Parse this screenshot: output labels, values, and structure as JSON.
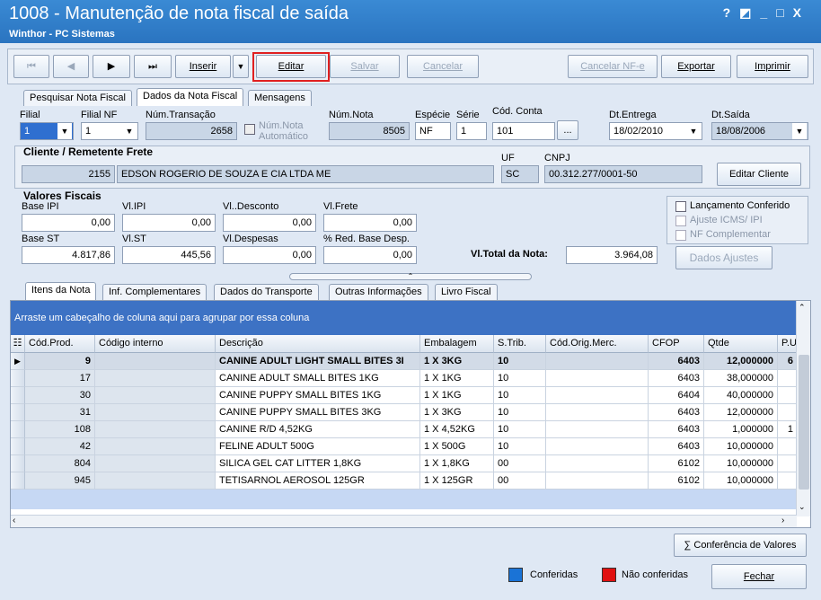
{
  "window": {
    "title": "1008 - Manutenção de nota fiscal de saída",
    "subtitle": "Winthor - PC Sistemas",
    "controls": [
      "?",
      "◩",
      "_",
      "□",
      "X"
    ]
  },
  "toolbar": {
    "first": "⏮",
    "prev": "◀",
    "next": "▶",
    "last": "⏭",
    "inserir": "Inserir",
    "dropdown": "▼",
    "editar": "Editar",
    "salvar": "Salvar",
    "cancelar": "Cancelar",
    "cancelar_nfe": "Cancelar NF-e",
    "exportar": "Exportar",
    "imprimir": "Imprimir",
    "highlight_color": "#e02020"
  },
  "main_tabs": [
    "Pesquisar Nota Fiscal",
    "Dados da Nota Fiscal",
    "Mensagens"
  ],
  "form": {
    "filial_label": "Filial",
    "filial_value": "1",
    "filial_nf_label": "Filial NF",
    "filial_nf_value": "1",
    "num_transacao_label": "Núm.Transação",
    "num_transacao_value": "2658",
    "num_nota_auto_label": "Núm.Nota Automático",
    "num_nota_label": "Núm.Nota",
    "num_nota_value": "8505",
    "especie_label": "Espécie",
    "especie_value": "NF",
    "serie_label": "Série",
    "serie_value": "1",
    "cod_conta_label": "Cód. Conta",
    "cod_conta_value": "101",
    "cod_conta_btn": "...",
    "dt_entrega_label": "Dt.Entrega",
    "dt_entrega_value": "18/02/2010",
    "dt_saida_label": "Dt.Saída",
    "dt_saida_value": "18/08/2006"
  },
  "cliente": {
    "section_label": "Cliente / Remetente Frete",
    "codigo": "2155",
    "nome": "EDSON ROGERIO DE SOUZA E CIA LTDA ME",
    "uf_label": "UF",
    "uf_value": "SC",
    "cnpj_label": "CNPJ",
    "cnpj_value": "00.312.277/0001-50",
    "editar_btn": "Editar Cliente"
  },
  "valores": {
    "section_label": "Valores Fiscais",
    "base_ipi_label": "Base IPI",
    "base_ipi_value": "0,00",
    "vl_ipi_label": "Vl.IPI",
    "vl_ipi_value": "0,00",
    "vl_desconto_label": "Vl..Desconto",
    "vl_desconto_value": "0,00",
    "vl_frete_label": "Vl.Frete",
    "vl_frete_value": "0,00",
    "base_st_label": "Base ST",
    "base_st_value": "4.817,86",
    "vl_st_label": "Vl.ST",
    "vl_st_value": "445,56",
    "vl_despesas_label": "Vl.Despesas",
    "vl_despesas_value": "0,00",
    "red_base_label": "% Red. Base Desp.",
    "red_base_value": "0,00",
    "total_label": "Vl.Total da Nota:",
    "total_value": "3.964,08"
  },
  "options": {
    "lancamento": "Lançamento Conferido",
    "ajuste": "Ajuste ICMS/ IPI",
    "nf_complementar": "NF Complementar",
    "dados_ajustes": "Dados Ajustes"
  },
  "sub_tabs": [
    "Itens da Nota",
    "Inf. Complementares",
    "Dados do Transporte",
    "Outras Informações",
    "Livro Fiscal"
  ],
  "grid": {
    "group_hint": "Arraste um cabeçalho de coluna aqui para agrupar por essa coluna",
    "columns": [
      "Cód.Prod.",
      "Código interno",
      "Descrição",
      "Embalagem",
      "S.Trib.",
      "Cód.Orig.Merc.",
      "CFOP",
      "Qtde",
      "P.U"
    ],
    "rows": [
      [
        "9",
        "",
        "CANINE ADULT LIGHT SMALL BITES 3I",
        "1 X 3KG",
        "10",
        "",
        "6403",
        "12,000000",
        "6"
      ],
      [
        "17",
        "",
        "CANINE ADULT SMALL BITES 1KG",
        "1 X 1KG",
        "10",
        "",
        "6403",
        "38,000000",
        ""
      ],
      [
        "30",
        "",
        "CANINE PUPPY SMALL BITES 1KG",
        "1 X 1KG",
        "10",
        "",
        "6404",
        "40,000000",
        ""
      ],
      [
        "31",
        "",
        "CANINE PUPPY SMALL BITES 3KG",
        "1 X 3KG",
        "10",
        "",
        "6403",
        "12,000000",
        ""
      ],
      [
        "108",
        "",
        "CANINE R/D 4,52KG",
        "1 X 4,52KG",
        "10",
        "",
        "6403",
        "1,000000",
        "1"
      ],
      [
        "42",
        "",
        "FELINE ADULT 500G",
        "1 X 500G",
        "10",
        "",
        "6403",
        "10,000000",
        ""
      ],
      [
        "804",
        "",
        "SILICA GEL CAT LITTER 1,8KG",
        "1 X 1,8KG",
        "00",
        "",
        "6102",
        "10,000000",
        ""
      ],
      [
        "945",
        "",
        "TETISARNOL AEROSOL 125GR",
        "1 X 125GR",
        "00",
        "",
        "6102",
        "10,000000",
        ""
      ]
    ]
  },
  "footer": {
    "conferencia_btn": "Conferência de Valores",
    "conferidas": "Conferidas",
    "conferidas_color": "#1a73d6",
    "nao_conferidas": "Não conferidas",
    "nao_conferidas_color": "#e01010",
    "fechar": "Fechar"
  }
}
